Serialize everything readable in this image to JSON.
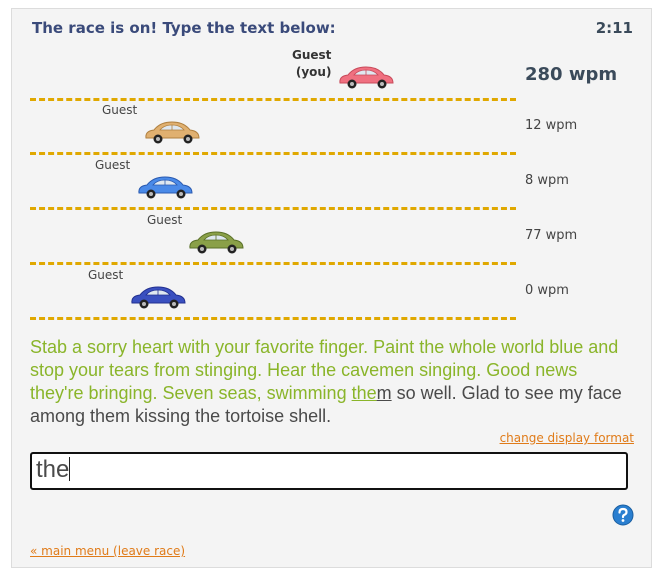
{
  "header": {
    "title": "The race is on! Type the text below:",
    "timer": "2:11"
  },
  "racers": [
    {
      "name": "Guest",
      "you_label": "(you)",
      "wpm": "280 wpm",
      "is_you": true,
      "car_color": "#f07080",
      "car_shade": "#c84a5a"
    },
    {
      "name": "Guest",
      "wpm": "12 wpm",
      "is_you": false,
      "car_color": "#e0b070",
      "car_shade": "#b08040"
    },
    {
      "name": "Guest",
      "wpm": "8 wpm",
      "is_you": false,
      "car_color": "#4a8ae8",
      "car_shade": "#2a5ab0"
    },
    {
      "name": "Guest",
      "wpm": "77 wpm",
      "is_you": false,
      "car_color": "#8aa048",
      "car_shade": "#5a7028"
    },
    {
      "name": "Guest",
      "wpm": "0 wpm",
      "is_you": false,
      "car_color": "#3a50c0",
      "car_shade": "#223090"
    }
  ],
  "passage": {
    "typed": "Stab a sorry heart with your favorite finger. Paint the whole world blue and stop your tears from stinging. Hear the cavemen singing. Good news they're bringing. Seven seas, swimming ",
    "current_typed": "the",
    "current_rest": "m",
    "remaining": " so well. Glad to see my face among them kissing the tortoise shell."
  },
  "links": {
    "change_format": "change display format",
    "main_menu": "« main menu (leave race)"
  },
  "input": {
    "value": "the"
  },
  "icons": {
    "help": "help-icon",
    "car": "car-icon"
  }
}
